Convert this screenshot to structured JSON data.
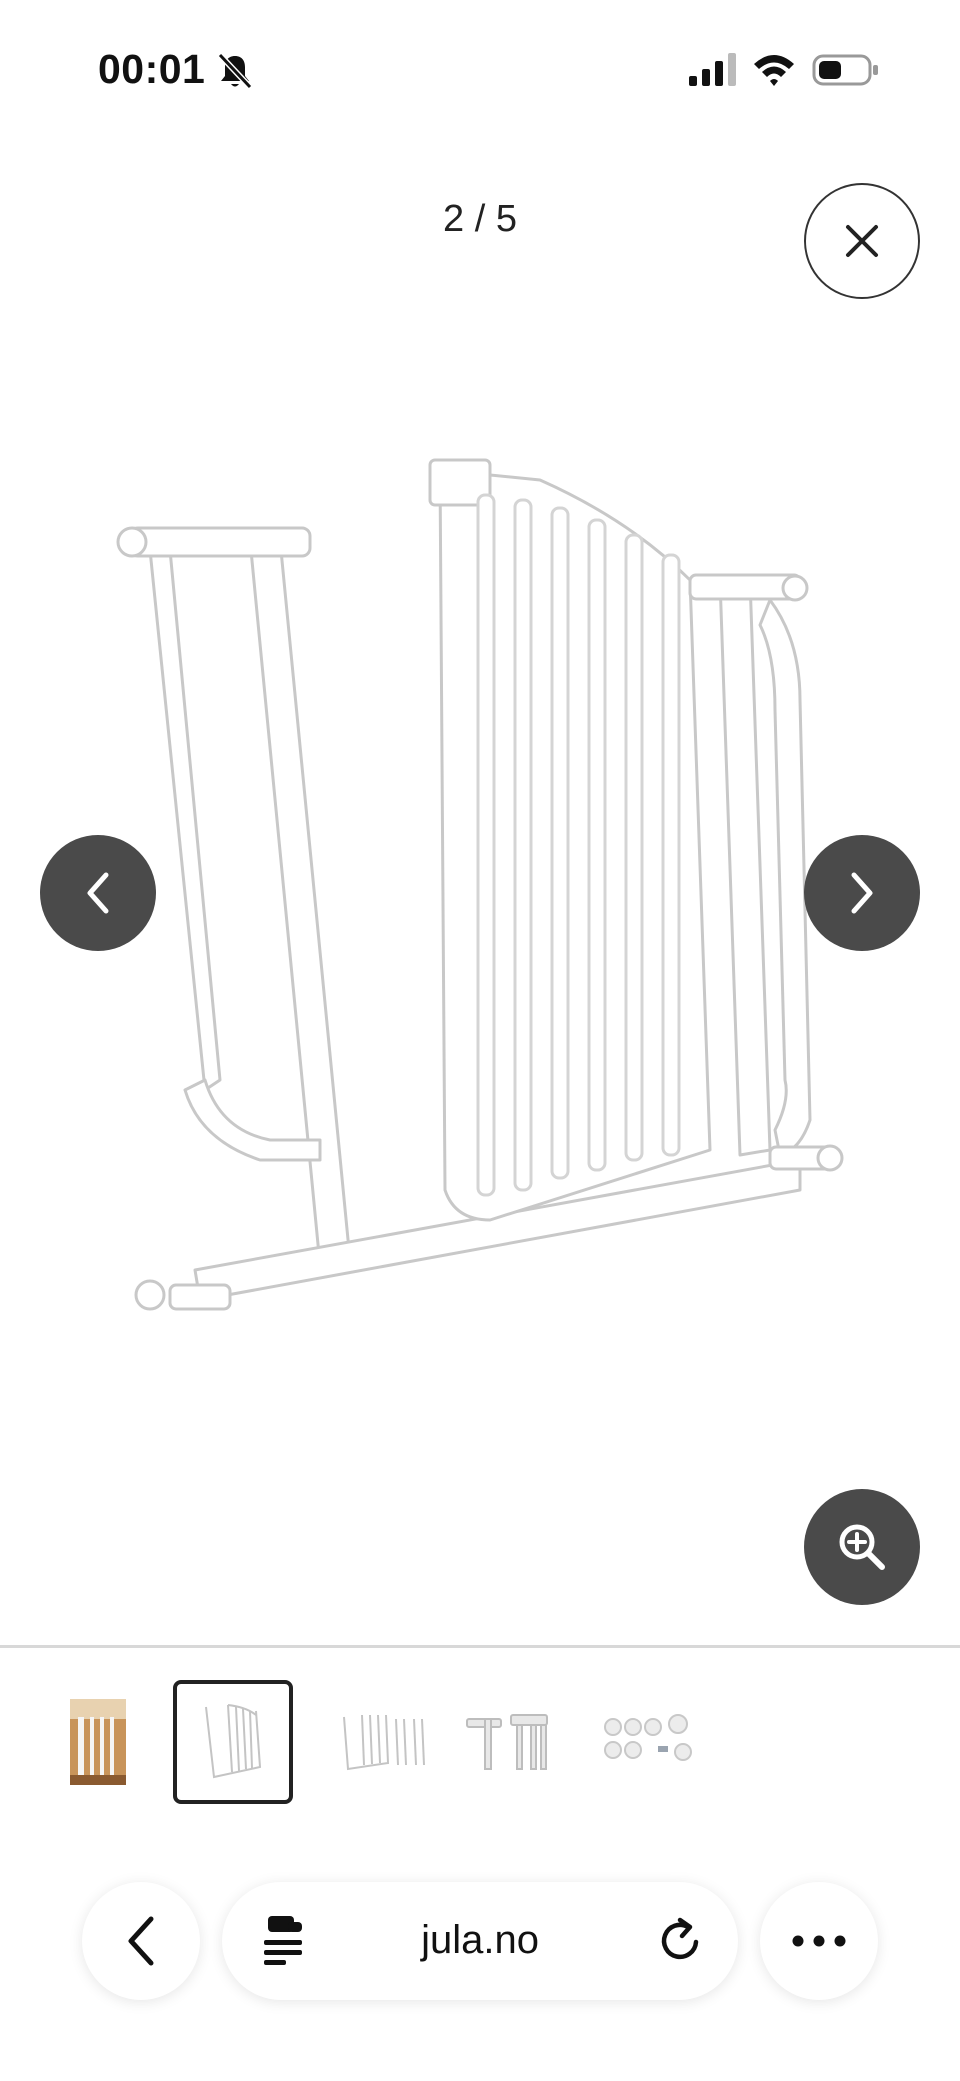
{
  "status_bar": {
    "time": "00:01",
    "icons": [
      "bell-slash-icon",
      "cellular-signal-icon",
      "wifi-icon",
      "battery-icon"
    ]
  },
  "gallery": {
    "counter": "2 / 5",
    "icons": {
      "close": "close-icon",
      "prev": "chevron-left-icon",
      "next": "chevron-right-icon",
      "zoom": "zoom-in-icon"
    },
    "thumbnails": [
      {
        "name": "thumbnail-1",
        "selected": false
      },
      {
        "name": "thumbnail-2",
        "selected": true
      },
      {
        "name": "thumbnail-3",
        "selected": false
      },
      {
        "name": "thumbnail-4",
        "selected": false
      },
      {
        "name": "thumbnail-5",
        "selected": false
      }
    ]
  },
  "browser": {
    "url": "jula.no",
    "icons": [
      "chevron-left-icon",
      "reader-icon",
      "reload-icon",
      "more-icon"
    ]
  },
  "colors": {
    "dark_button": "#4a4a4a",
    "divider": "#d8d8d8"
  }
}
